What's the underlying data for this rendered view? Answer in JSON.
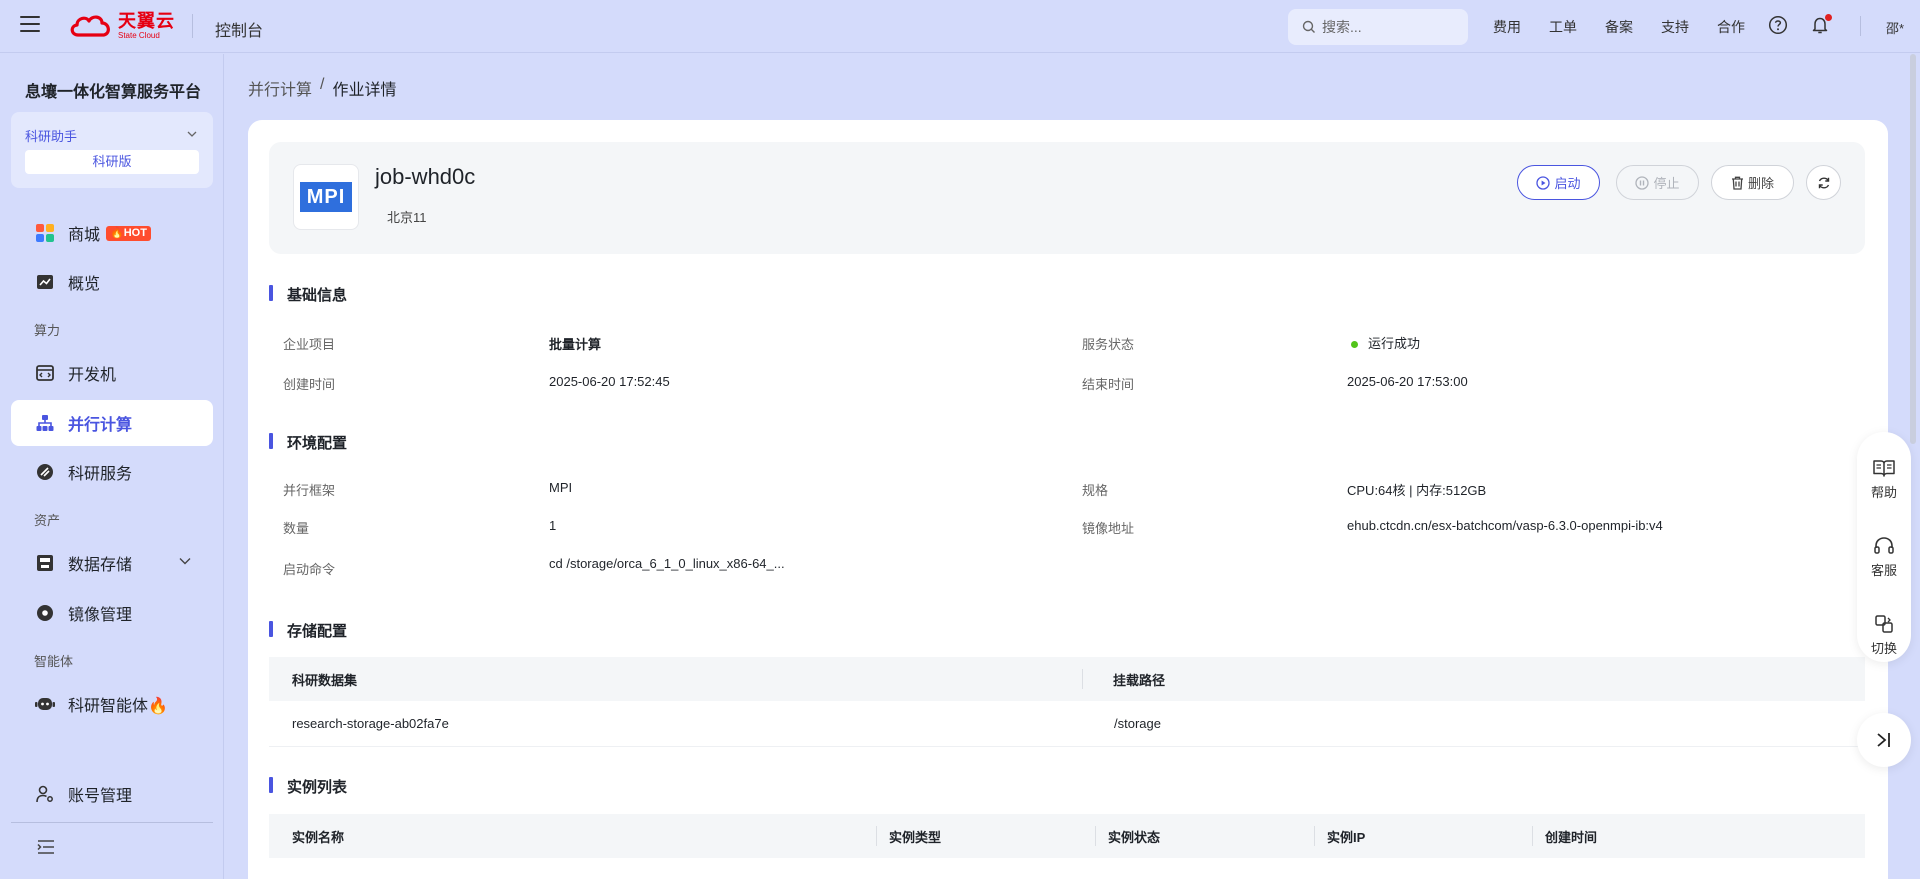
{
  "topbar": {
    "brand_cn": "天翼云",
    "brand_en": "State Cloud",
    "console": "控制台",
    "search_placeholder": "搜索...",
    "nav": [
      "费用",
      "工单",
      "备案",
      "支持",
      "合作"
    ],
    "user": "邵*"
  },
  "sidebar": {
    "platform_title": "息壤一体化智算服务平台",
    "assistant": "科研助手",
    "edition": "科研版",
    "items": {
      "mall": "商城",
      "mall_badge": "HOT",
      "overview": "概览",
      "group_compute": "算力",
      "devbox": "开发机",
      "parallel": "并行计算",
      "research_service": "科研服务",
      "group_assets": "资产",
      "storage": "数据存储",
      "image": "镜像管理",
      "group_agent": "智能体",
      "agent": "科研智能体🔥",
      "account": "账号管理"
    }
  },
  "breadcrumb": {
    "parent": "并行计算",
    "sep": "/",
    "current": "作业详情"
  },
  "job": {
    "icon_text": "MPI",
    "name": "job-whd0c",
    "region": "北京11",
    "btn_start": "启动",
    "btn_stop": "停止",
    "btn_delete": "删除"
  },
  "basic": {
    "title": "基础信息",
    "project_label": "企业项目",
    "project_value": "批量计算",
    "status_label": "服务状态",
    "status_value": "运行成功",
    "created_label": "创建时间",
    "created_value": "2025-06-20 17:52:45",
    "ended_label": "结束时间",
    "ended_value": "2025-06-20 17:53:00"
  },
  "env": {
    "title": "环境配置",
    "framework_label": "并行框架",
    "framework_value": "MPI",
    "spec_label": "规格",
    "spec_value": "CPU:64核 | 内存:512GB",
    "count_label": "数量",
    "count_value": "1",
    "image_label": "镜像地址",
    "image_value": "ehub.ctcdn.cn/esx-batchcom/vasp-6.3.0-openmpi-ib:v4",
    "cmd_label": "启动命令",
    "cmd_value": "cd /storage/orca_6_1_0_linux_x86-64_..."
  },
  "storage": {
    "title": "存储配置",
    "col_dataset": "科研数据集",
    "col_mount": "挂载路径",
    "rows": [
      {
        "dataset": "research-storage-ab02fa7e",
        "mount": "/storage"
      }
    ]
  },
  "instances": {
    "title": "实例列表",
    "col_name": "实例名称",
    "col_type": "实例类型",
    "col_status": "实例状态",
    "col_ip": "实例IP",
    "col_created": "创建时间"
  },
  "float": {
    "help": "帮助",
    "service": "客服",
    "switch": "切换"
  },
  "colors": {
    "accent": "#4a55e0",
    "background": "#d4dbfb",
    "success": "#52c41a",
    "brand_red": "#e60012"
  }
}
